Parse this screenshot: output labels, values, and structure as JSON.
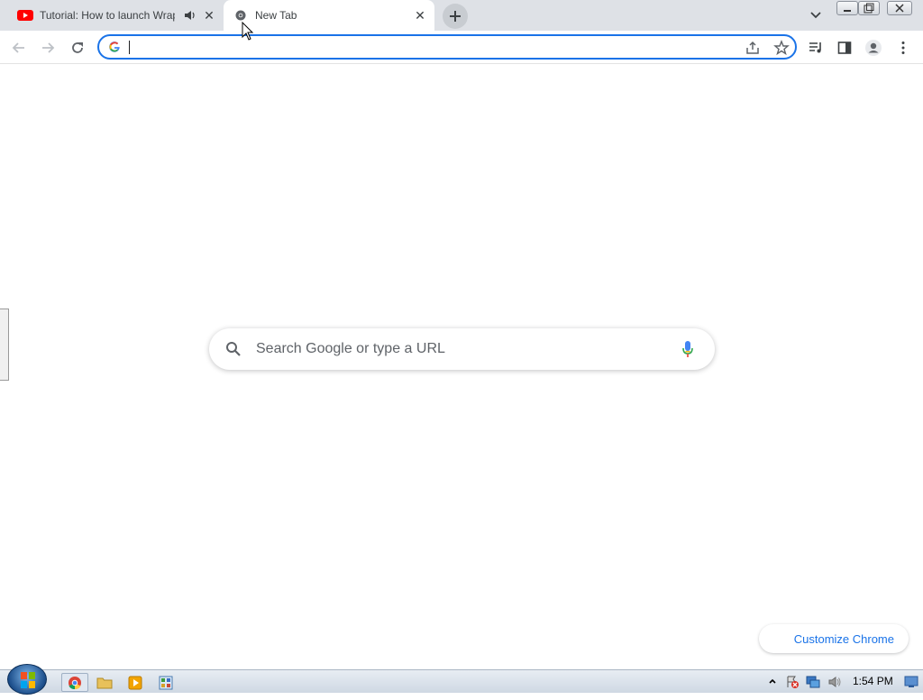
{
  "tabs": [
    {
      "title": "Tutorial: How to launch Wrap",
      "favicon": "youtube-icon",
      "audio": "speaker-icon"
    },
    {
      "title": "New Tab",
      "favicon": "chrome-icon"
    }
  ],
  "omnibox": {
    "value": "",
    "provider_icon": "google-g-icon"
  },
  "ntp": {
    "search_placeholder": "Search Google or type a URL",
    "customize_label": "Customize Chrome"
  },
  "taskbar": {
    "clock": "1:54 PM",
    "apps": [
      "chrome-icon",
      "folder-icon",
      "media-player-icon",
      "control-panel-icon"
    ]
  },
  "colors": {
    "accent": "#1a73e8",
    "tabstrip": "#dee1e6",
    "youtube": "#ff0000"
  }
}
